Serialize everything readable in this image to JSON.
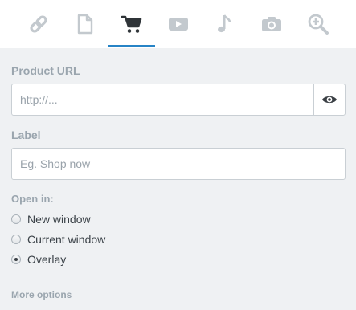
{
  "tabs": [
    {
      "icon": "link-icon",
      "active": false
    },
    {
      "icon": "page-icon",
      "active": false
    },
    {
      "icon": "cart-icon",
      "active": true
    },
    {
      "icon": "video-icon",
      "active": false
    },
    {
      "icon": "music-icon",
      "active": false
    },
    {
      "icon": "camera-icon",
      "active": false
    },
    {
      "icon": "zoom-icon",
      "active": false
    }
  ],
  "colors": {
    "accent": "#2784c6",
    "icon": "#c3c9ce",
    "icon_active": "#2f3438",
    "panel": "#eff1f3"
  },
  "product_url": {
    "label": "Product URL",
    "value": "",
    "placeholder": "http://..."
  },
  "label_field": {
    "label": "Label",
    "value": "",
    "placeholder": "Eg. Shop now"
  },
  "open_in": {
    "label": "Open in:",
    "options": [
      {
        "label": "New window",
        "checked": false
      },
      {
        "label": "Current window",
        "checked": false
      },
      {
        "label": "Overlay",
        "checked": true
      }
    ]
  },
  "more_options": "More options"
}
